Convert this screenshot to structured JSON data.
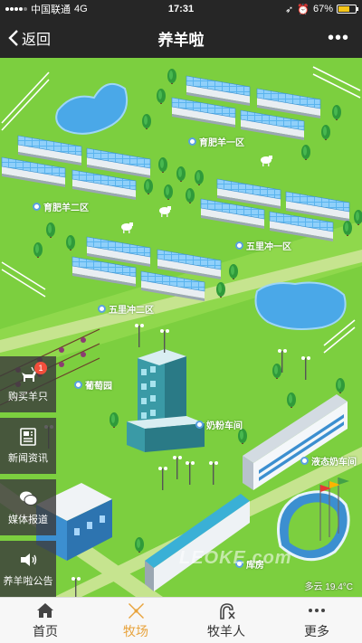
{
  "status_bar": {
    "carrier": "中国联通",
    "network": "4G",
    "time": "17:31",
    "battery": "67%",
    "battery_level": 0.67
  },
  "nav": {
    "back_label": "返回",
    "title": "养羊啦",
    "more_label": "•••"
  },
  "map": {
    "zones": [
      {
        "label": "育肥羊一区"
      },
      {
        "label": "育肥羊二区"
      },
      {
        "label": "五里冲一区"
      },
      {
        "label": "五里冲二区"
      },
      {
        "label": "葡萄园"
      },
      {
        "label": "奶粉车间"
      },
      {
        "label": "液态奶车间"
      },
      {
        "label": "库房"
      }
    ],
    "weather": "多云 19.4°C",
    "watermark": "LEOKE.com"
  },
  "side_menu": {
    "items": [
      {
        "label": "购买羊只",
        "icon": "goat-icon",
        "badge": "1"
      },
      {
        "label": "新闻资讯",
        "icon": "newspaper-icon"
      },
      {
        "label": "媒体报道",
        "icon": "chat-icon"
      },
      {
        "label": "养羊啦公告",
        "icon": "speaker-icon"
      }
    ]
  },
  "tab_bar": {
    "tabs": [
      {
        "label": "首页",
        "icon": "home-icon"
      },
      {
        "label": "牧场",
        "icon": "windmill-icon",
        "active": true
      },
      {
        "label": "牧羊人",
        "icon": "shepherd-icon"
      },
      {
        "label": "更多",
        "icon": "more-icon"
      }
    ]
  },
  "colors": {
    "grass": "#7ccf3f",
    "road": "#c6e48f",
    "water": "#4aa8e8",
    "active_tab": "#e8a33c",
    "bar_bg": "#262626"
  }
}
